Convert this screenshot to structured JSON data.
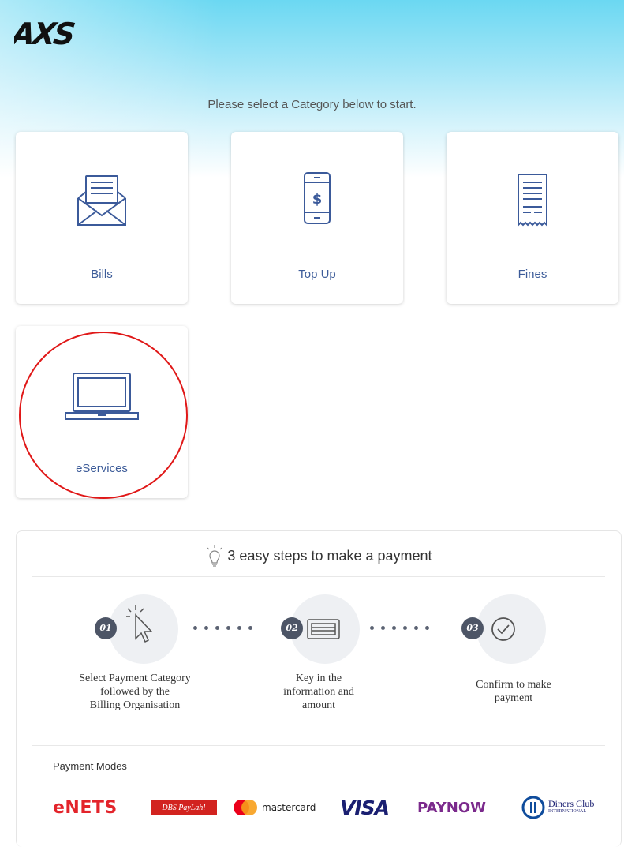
{
  "brand": {
    "logo_text": "AXS"
  },
  "header": {
    "subtitle": "Please select a Category below to start."
  },
  "categories": [
    {
      "label": "Bills",
      "icon": "envelope-bill-icon"
    },
    {
      "label": "Top Up",
      "icon": "mobile-topup-icon"
    },
    {
      "label": "Fines",
      "icon": "receipt-icon"
    },
    {
      "label": "eServices",
      "icon": "laptop-icon"
    }
  ],
  "steps": {
    "title": "3 easy steps to make a payment",
    "items": [
      {
        "number": "01",
        "lines": [
          "Select Payment Category",
          "followed by the",
          "Billing Organisation"
        ],
        "icon": "cursor-click-icon"
      },
      {
        "number": "02",
        "lines": [
          "Key in the",
          "information and",
          "amount"
        ],
        "icon": "card-input-icon"
      },
      {
        "number": "03",
        "lines": [
          "Confirm to make",
          "payment"
        ],
        "icon": "check-circle-icon"
      }
    ]
  },
  "payment_modes": {
    "label": "Payment Modes",
    "items": [
      {
        "name": "eNETS",
        "icon": "enets-logo"
      },
      {
        "name": "DBS PayLah!",
        "icon": "dbs-paylah-logo"
      },
      {
        "name": "mastercard",
        "icon": "mastercard-logo"
      },
      {
        "name": "VISA",
        "icon": "visa-logo"
      },
      {
        "name": "PAYNOW",
        "icon": "paynow-logo"
      },
      {
        "name": "Diners Club",
        "sub": "INTERNATIONAL",
        "icon": "diners-club-logo"
      }
    ]
  },
  "colors": {
    "accent_text": "#3d5c99",
    "icon_blue": "#3b5a9a",
    "highlight": "#e01818",
    "hero_top": "#6bd8f2"
  }
}
